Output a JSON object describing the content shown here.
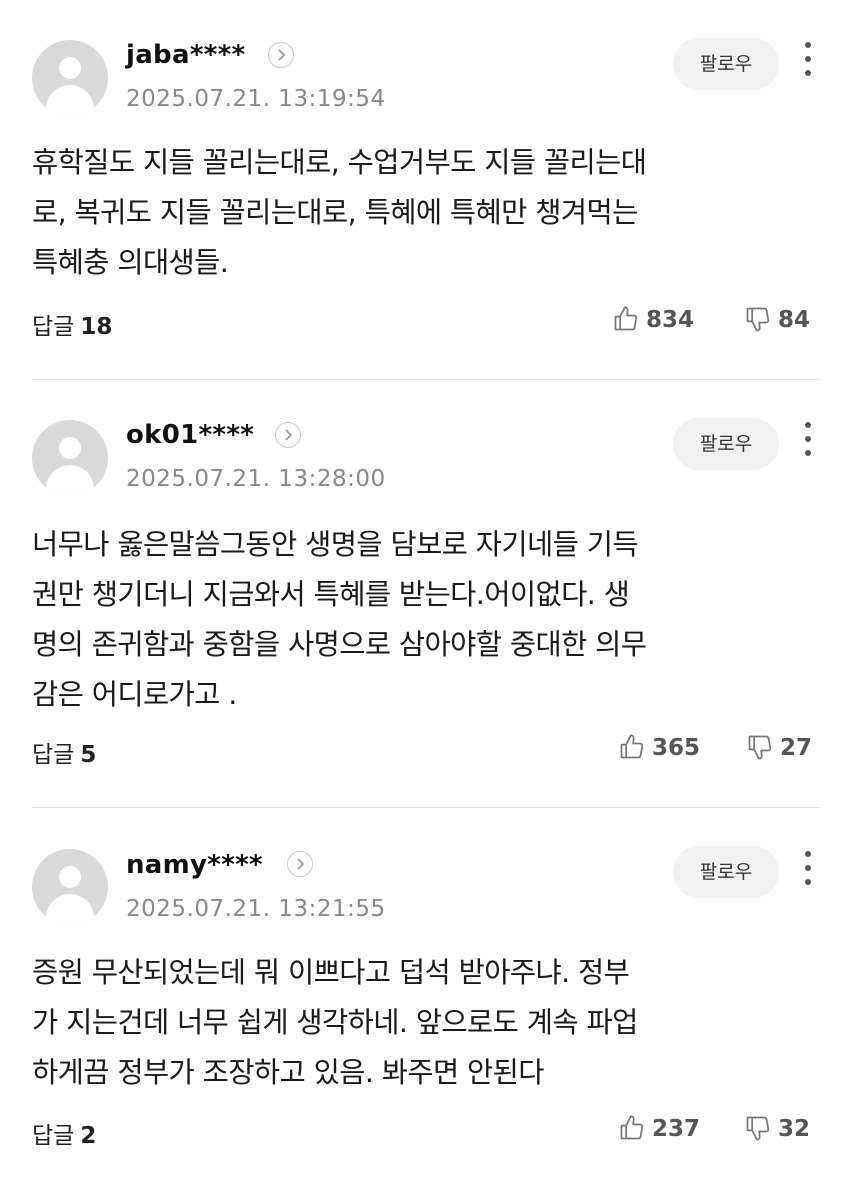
{
  "follow_label": "팔로우",
  "reply_label": "답글",
  "comments": [
    {
      "username": "jaba****",
      "timestamp": "2025.07.21. 13:19:54",
      "lines": [
        "휴학질도 지들 꼴리는대로, 수업거부도 지들 꼴리는대",
        "로, 복귀도 지들 꼴리는대로, 특혜에 특혜만 챙겨먹는",
        "특혜충 의대생들."
      ],
      "replies": "18",
      "likes": "834",
      "dislikes": "84"
    },
    {
      "username": "ok01****",
      "timestamp": "2025.07.21. 13:28:00",
      "lines": [
        "너무나 옳은말씀그동안 생명을 담보로 자기네들 기득",
        "권만 챙기더니 지금와서 특혜를 받는다.어이없다. 생",
        "명의 존귀함과 중함을 사명으로 삼아야할 중대한 의무",
        "감은 어디로가고 ."
      ],
      "replies": "5",
      "likes": "365",
      "dislikes": "27"
    },
    {
      "username": "namy****",
      "timestamp": "2025.07.21. 13:21:55",
      "lines": [
        "증원 무산되었는데 뭐 이쁘다고 덥석 받아주냐. 정부",
        "가 지는건데 너무 쉽게 생각하네. 앞으로도 계속 파업",
        "하게끔 정부가 조장하고 있음. 봐주면 안된다"
      ],
      "replies": "2",
      "likes": "237",
      "dislikes": "32"
    }
  ]
}
